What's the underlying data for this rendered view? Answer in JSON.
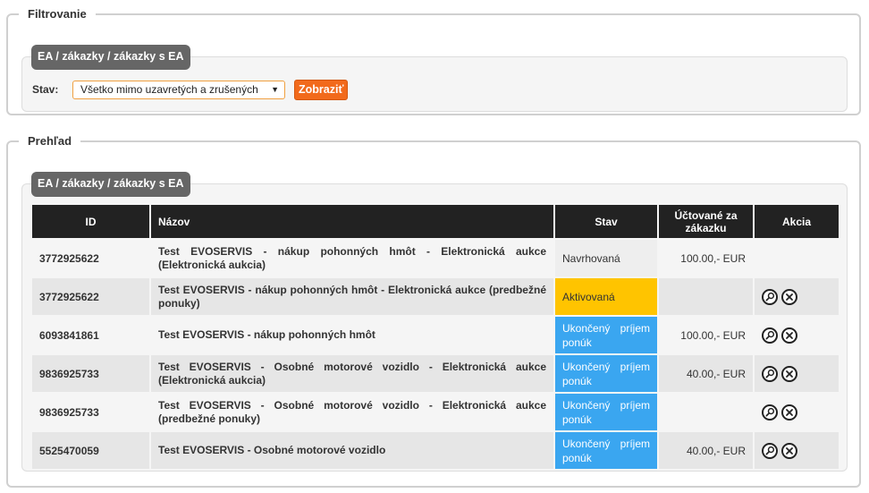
{
  "filter": {
    "legend": "Filtrovanie",
    "breadcrumb": "EA / zákazky / zákazky s EA",
    "stav_label": "Stav:",
    "stav_value": "Všetko mimo uzavretých a zrušených",
    "show_button": "Zobraziť"
  },
  "overview": {
    "legend": "Prehľad",
    "breadcrumb": "EA / zákazky / zákazky s EA",
    "headers": {
      "id": "ID",
      "name": "Názov",
      "stav": "Stav",
      "price": "Účtované za zákazku",
      "actions": "Akcia"
    },
    "rows": [
      {
        "id": "3772925622",
        "name": "Test EVOSERVIS - nákup pohonných hmôt - Elektronická aukce (Elektronická aukcia)",
        "stav": "Navrhovaná",
        "price": "100.00,- EUR"
      },
      {
        "id": "3772925622",
        "name": "Test EVOSERVIS - nákup pohonných hmôt - Elektronická aukce (predbežné ponuky)",
        "stav": "Aktivovaná",
        "price": ""
      },
      {
        "id": "6093841861",
        "name": "Test EVOSERVIS - nákup pohonných hmôt",
        "stav": "Ukončený príjem ponúk",
        "price": "100.00,- EUR"
      },
      {
        "id": "9836925733",
        "name": "Test EVOSERVIS - Osobné motorové vozidlo - Elektronická aukce (Elektronická aukcia)",
        "stav": "Ukončený príjem ponúk",
        "price": "40.00,- EUR"
      },
      {
        "id": "9836925733",
        "name": "Test EVOSERVIS - Osobné motorové vozidlo - Elektronická aukce (predbežné ponuky)",
        "stav": "Ukončený príjem ponúk",
        "price": ""
      },
      {
        "id": "5525470059",
        "name": "Test EVOSERVIS - Osobné motorové vozidlo",
        "stav": "Ukončený príjem ponúk",
        "price": "40.00,- EUR"
      }
    ]
  },
  "icons": {
    "view": "magnifier-icon",
    "delete": "close-circle-icon"
  },
  "colors": {
    "button_orange": "#f26a1b",
    "status_draft": "#eeeeee",
    "status_active": "#ffc400",
    "status_closed": "#3aa6f0",
    "header_dark": "#222222",
    "breadcrumb_gray": "#666666"
  }
}
